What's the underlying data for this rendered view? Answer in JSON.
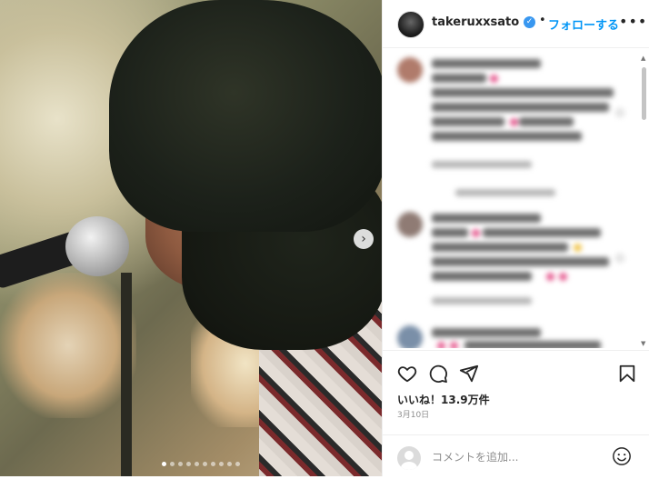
{
  "header": {
    "username": "takeruxxsato",
    "separator": "•",
    "follow_label": "フォローする",
    "more_label": "•••"
  },
  "photo": {
    "carousel_dots": 10,
    "active_dot": 0,
    "next_icon": "chevron-right-icon"
  },
  "actions": {
    "like_icon": "heart-icon",
    "comment_icon": "comment-icon",
    "share_icon": "send-icon",
    "save_icon": "bookmark-icon",
    "likes_text": "いいね！13.9万件",
    "date_text": "3月10日"
  },
  "comment_bar": {
    "placeholder": "コメントを追加...",
    "emoji_icon": "smiley-icon"
  },
  "colors": {
    "accent": "#0095f6",
    "verified": "#3897f0",
    "text": "#262626",
    "muted": "#8e8e8e"
  }
}
